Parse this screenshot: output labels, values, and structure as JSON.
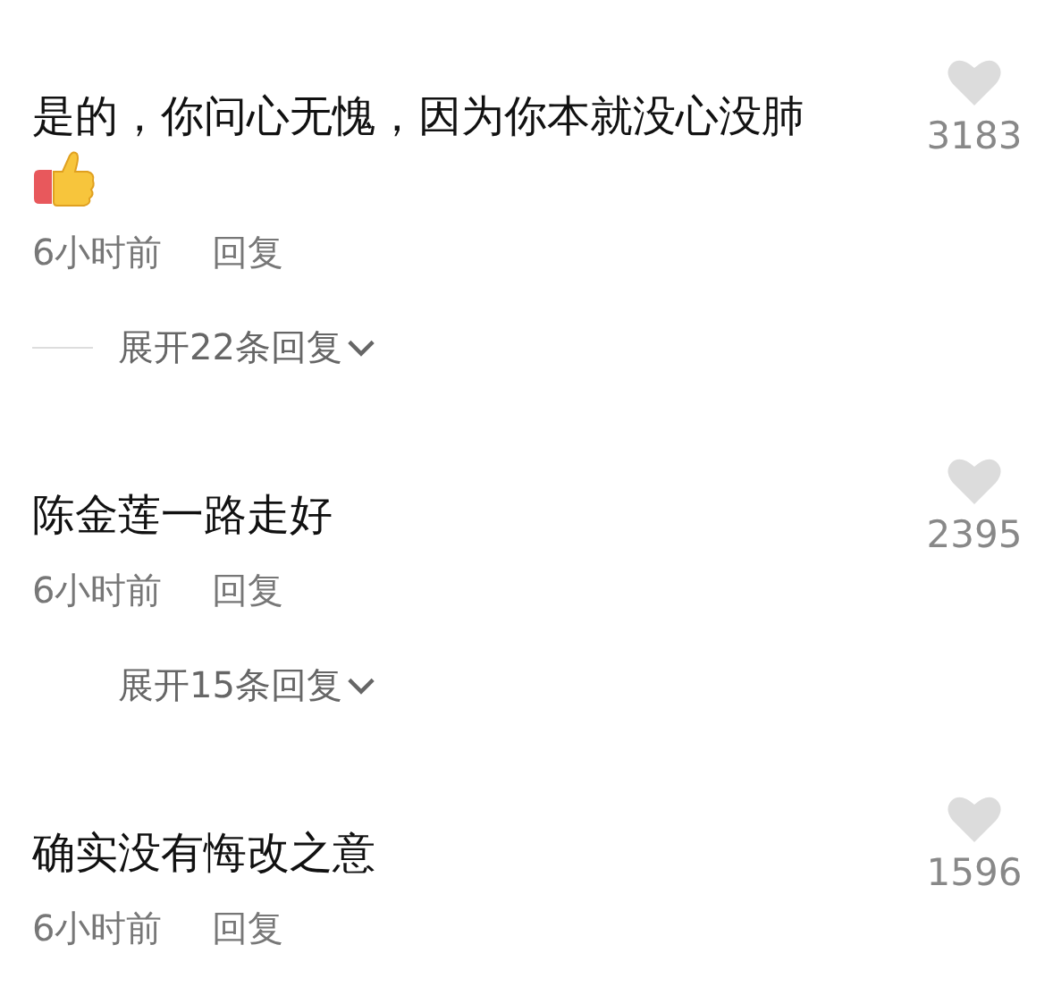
{
  "comments": [
    {
      "text": "是的，你问心无愧，因为你本就没心没肺",
      "thumbs_up_emoji": true,
      "likes": "3183",
      "time": "6小时前",
      "reply": "回复",
      "expand": {
        "label": "展开22条回复",
        "rule": true
      }
    },
    {
      "text": "陈金莲一路走好",
      "thumbs_up_emoji": false,
      "likes": "2395",
      "time": "6小时前",
      "reply": "回复",
      "expand": {
        "label": "展开15条回复",
        "rule": false
      }
    },
    {
      "text": "确实没有悔改之意",
      "thumbs_up_emoji": false,
      "likes": "1596",
      "time": "6小时前",
      "reply": "回复"
    }
  ]
}
